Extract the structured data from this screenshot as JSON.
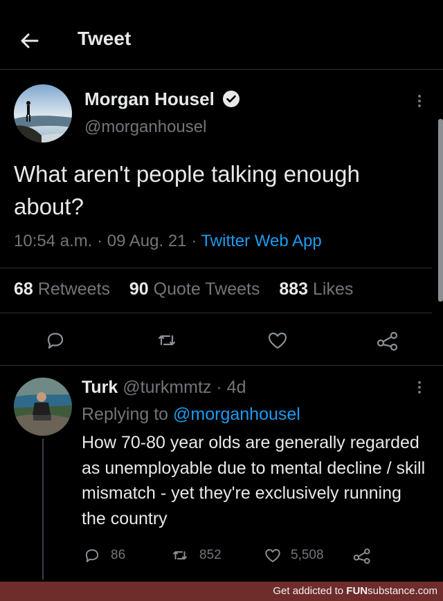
{
  "header": {
    "title": "Tweet",
    "back_icon": "back-arrow-icon"
  },
  "main_tweet": {
    "display_name": "Morgan Housel",
    "verified": true,
    "handle": "@morganhousel",
    "text": "What aren't people talking enough about?",
    "time": "10:54 a.m.",
    "date": "09 Aug. 21",
    "source": "Twitter Web App",
    "stats": {
      "retweets_count": "68",
      "retweets_label": "Retweets",
      "quotes_count": "90",
      "quotes_label": "Quote Tweets",
      "likes_count": "883",
      "likes_label": "Likes"
    }
  },
  "reply": {
    "display_name": "Turk",
    "handle": "@turkmmtz",
    "age": "4d",
    "replying_prefix": "Replying to",
    "replying_to": "@morganhousel",
    "text": "How 70-80 year olds are generally regarded as unemployable due to mental decline / skill mismatch - yet they're exclusively running the country",
    "stats": {
      "replies": "86",
      "retweets": "852",
      "likes": "5,508"
    }
  },
  "banner": {
    "prefix": "Get addicted to ",
    "brand_bold": "FUN",
    "brand_rest": "substance.com"
  },
  "colors": {
    "background": "#000000",
    "text": "#e7e9ea",
    "muted": "#71767b",
    "link": "#1d9bf0",
    "banner": "#6e2c2b"
  }
}
